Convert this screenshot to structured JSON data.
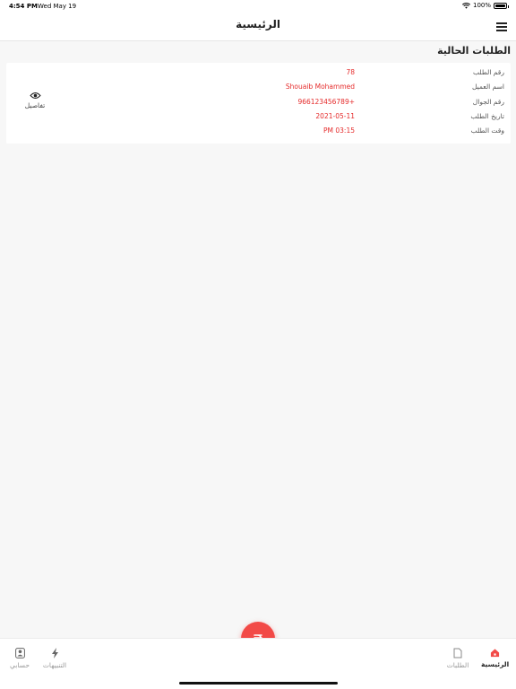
{
  "status_bar": {
    "time": "4:54 PM",
    "date": "Wed May 19",
    "battery_text": "100%",
    "battery_level": 1.0,
    "icons": [
      "wifi-icon",
      "battery-icon"
    ]
  },
  "nav": {
    "title": "الرئيسية",
    "menu_icon": "hamburger-menu-icon"
  },
  "section": {
    "title": "الطلبات الحالية"
  },
  "order": {
    "fields": [
      {
        "label": "رقم الطلب",
        "value": "78"
      },
      {
        "label": "اسم العميل",
        "value": "Shouaib Mohammed"
      },
      {
        "label": "رقم الجوال",
        "value": "966123456789+"
      },
      {
        "label": "تاريخ الطلب",
        "value": "2021-05-11"
      },
      {
        "label": "وقت الطلب",
        "value": "PM 03:15"
      }
    ],
    "details_label": "تفاصيل",
    "details_icon": "eye-icon"
  },
  "tabs": {
    "home": {
      "label": "الرئيسية",
      "icon": "home-icon",
      "active": true
    },
    "orders": {
      "label": "الطلبات",
      "icon": "document-icon"
    },
    "notifications": {
      "label": "التنبيهات",
      "icon": "lightning-icon"
    },
    "account": {
      "label": "حسابي",
      "icon": "user-icon"
    }
  },
  "fab": {
    "icon": "currency-icon"
  },
  "colors": {
    "accent": "#f24a47",
    "value_text": "#e52b2b",
    "background": "#f7f7f7"
  }
}
